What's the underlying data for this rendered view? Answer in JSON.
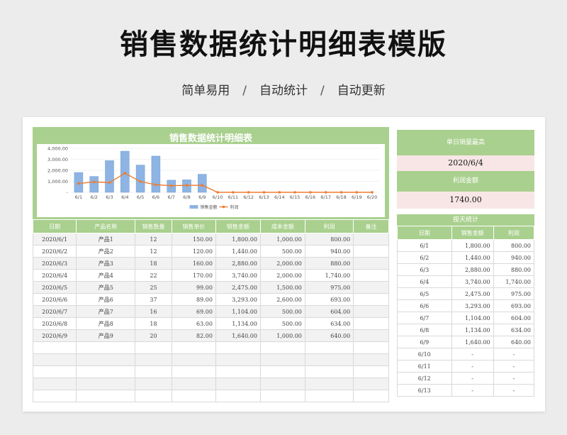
{
  "header": {
    "title": "销售数据统计明细表模版",
    "tags": [
      "简单易用",
      "自动统计",
      "自动更新"
    ],
    "separator": "/"
  },
  "chart_data": {
    "type": "bar",
    "title": "销售数据统计明细表",
    "categories": [
      "6/1",
      "6/2",
      "6/3",
      "6/4",
      "6/5",
      "6/6",
      "6/7",
      "6/8",
      "6/9",
      "6/10",
      "6/11",
      "6/12",
      "6/13",
      "6/14",
      "6/15",
      "6/16",
      "6/17",
      "6/18",
      "6/19",
      "6/20"
    ],
    "series": [
      {
        "name": "销售金额",
        "type": "bar",
        "color": "#8db4e2",
        "values": [
          1800,
          1440,
          2880,
          3740,
          2475,
          3293,
          1104,
          1134,
          1640,
          0,
          0,
          0,
          0,
          0,
          0,
          0,
          0,
          0,
          0,
          0
        ]
      },
      {
        "name": "利润",
        "type": "line",
        "color": "#ed7d31",
        "values": [
          800,
          940,
          880,
          1740,
          975,
          693,
          604,
          634,
          640,
          0,
          0,
          0,
          0,
          0,
          0,
          0,
          0,
          0,
          0,
          0
        ]
      }
    ],
    "ylim": [
      0,
      4000
    ],
    "yticks": [
      "4,000.00",
      "3,000.00",
      "2,000.00",
      "1,000.00",
      "-"
    ],
    "legend_position": "bottom"
  },
  "main_table": {
    "headers": [
      "日期",
      "产品名称",
      "销售数量",
      "销售单价",
      "销售金额",
      "成本金额",
      "利润",
      "备注"
    ],
    "rows": [
      [
        "2020/6/1",
        "产品1",
        "12",
        "150.00",
        "1,800.00",
        "1,000.00",
        "800.00",
        ""
      ],
      [
        "2020/6/2",
        "产品2",
        "12",
        "120.00",
        "1,440.00",
        "500.00",
        "940.00",
        ""
      ],
      [
        "2020/6/3",
        "产品3",
        "18",
        "160.00",
        "2,880.00",
        "2,000.00",
        "880.00",
        ""
      ],
      [
        "2020/6/4",
        "产品4",
        "22",
        "170.00",
        "3,740.00",
        "2,000.00",
        "1,740.00",
        ""
      ],
      [
        "2020/6/5",
        "产品5",
        "25",
        "99.00",
        "2,475.00",
        "1,500.00",
        "975.00",
        ""
      ],
      [
        "2020/6/6",
        "产品6",
        "37",
        "89.00",
        "3,293.00",
        "2,600.00",
        "693.00",
        ""
      ],
      [
        "2020/6/7",
        "产品7",
        "16",
        "69.00",
        "1,104.00",
        "500.00",
        "604.00",
        ""
      ],
      [
        "2020/6/8",
        "产品8",
        "18",
        "63.00",
        "1,134.00",
        "500.00",
        "634.00",
        ""
      ],
      [
        "2020/6/9",
        "产品9",
        "20",
        "82.00",
        "1,640.00",
        "1,000.00",
        "640.00",
        ""
      ],
      [
        "",
        "",
        "",
        "",
        "",
        "",
        "",
        ""
      ],
      [
        "",
        "",
        "",
        "",
        "",
        "",
        "",
        ""
      ],
      [
        "",
        "",
        "",
        "",
        "",
        "",
        "",
        ""
      ],
      [
        "",
        "",
        "",
        "",
        "",
        "",
        "",
        ""
      ],
      [
        "",
        "",
        "",
        "",
        "",
        "",
        "",
        ""
      ]
    ]
  },
  "side": {
    "max_label": "单日销量最高",
    "max_value": "2020/6/4",
    "profit_label": "利润金额",
    "profit_value": "1740.00",
    "daily_label": "按天统计",
    "headers": [
      "日期",
      "销售金额",
      "利润"
    ],
    "rows": [
      [
        "6/1",
        "1,800.00",
        "800.00"
      ],
      [
        "6/2",
        "1,440.00",
        "940.00"
      ],
      [
        "6/3",
        "2,880.00",
        "880.00"
      ],
      [
        "6/4",
        "3,740.00",
        "1,740.00"
      ],
      [
        "6/5",
        "2,475.00",
        "975.00"
      ],
      [
        "6/6",
        "3,293.00",
        "693.00"
      ],
      [
        "6/7",
        "1,104.00",
        "604.00"
      ],
      [
        "6/8",
        "1,134.00",
        "634.00"
      ],
      [
        "6/9",
        "1,640.00",
        "640.00"
      ],
      [
        "6/10",
        "-",
        "-"
      ],
      [
        "6/11",
        "-",
        "-"
      ],
      [
        "6/12",
        "-",
        "-"
      ],
      [
        "6/13",
        "-",
        "-"
      ]
    ]
  }
}
